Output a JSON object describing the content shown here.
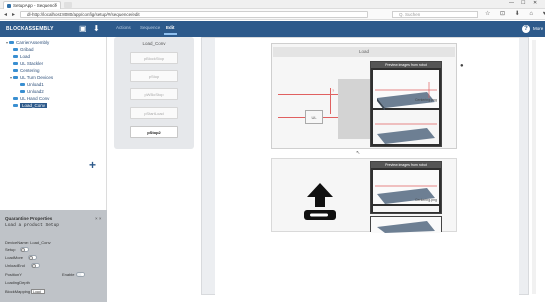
{
  "browser": {
    "tab_title": "SetupApp - Sequence",
    "tab_close": "×",
    "url": "dl-http://localhost:8080/app/config/setup/#/sequence/edit",
    "search_placeholder": "Q. Suchen",
    "window_controls": [
      "—",
      "☐",
      "✕"
    ],
    "toolbar_icons": "☆ ⊡ ⬇ ⌂ ♥ ≡"
  },
  "app": {
    "name": "BLOCKASSEMBLY",
    "tabs": [
      "Actions",
      "Sequence",
      "Edit"
    ],
    "active_tab": "Edit",
    "help_label": "?",
    "help_text": "More"
  },
  "tree": {
    "items": [
      {
        "label": "CarrierAssembly",
        "level": 0,
        "toggle": "▾",
        "selected": false
      },
      {
        "label": "Gribad",
        "level": 1,
        "toggle": "",
        "selected": false
      },
      {
        "label": "Load",
        "level": 1,
        "toggle": "",
        "selected": false
      },
      {
        "label": "UL Stackler",
        "level": 1,
        "toggle": "",
        "selected": false
      },
      {
        "label": "Centering",
        "level": 1,
        "toggle": "",
        "selected": false
      },
      {
        "label": "UL Turn Devices",
        "level": 1,
        "toggle": "▾",
        "selected": false
      },
      {
        "label": "Unload1",
        "level": 2,
        "toggle": "",
        "selected": false
      },
      {
        "label": "Unload2",
        "level": 2,
        "toggle": "",
        "selected": false
      },
      {
        "label": "UL Hand Conv",
        "level": 1,
        "toggle": "",
        "selected": false
      },
      {
        "label": "Load_Conv",
        "level": 1,
        "toggle": "",
        "selected": true
      }
    ],
    "add_label": "+"
  },
  "properties": {
    "title": "Quarantine Properties",
    "close": "× ×",
    "subtitle": "Load a product Setup",
    "rows": [
      {
        "label": "DeviceName: Load_Conv"
      },
      {
        "label": "Setup"
      },
      {
        "label": "LoadMore"
      },
      {
        "label": "UnloadEnd"
      },
      {
        "label": "PositionY"
      },
      {
        "label": "LoadingDepth"
      },
      {
        "label": "BlockMapping"
      }
    ],
    "second_toggle_label": "Enable",
    "dropdown_value": "Load"
  },
  "load_panel": {
    "title": "Load_Conv",
    "buttons": [
      {
        "label": "pBlockStop",
        "active": false
      },
      {
        "label": "pStop",
        "active": false
      },
      {
        "label": "pWBoStop",
        "active": false
      },
      {
        "label": "pStartLoad",
        "active": false
      },
      {
        "label": "pStop2",
        "active": true
      }
    ]
  },
  "canvas": {
    "load_title": "Load",
    "block_label": "UL",
    "preview_header": "Preview images from robot",
    "preview_label": "Centering.png",
    "marker": "?",
    "upload_icon": "upload-icon",
    "corner_icon": "●"
  },
  "colors": {
    "appbar": "#2d5a8b",
    "tree_text": "#2d4f7a",
    "tree_icon": "#3a8fd1",
    "laser": "#e06060"
  }
}
